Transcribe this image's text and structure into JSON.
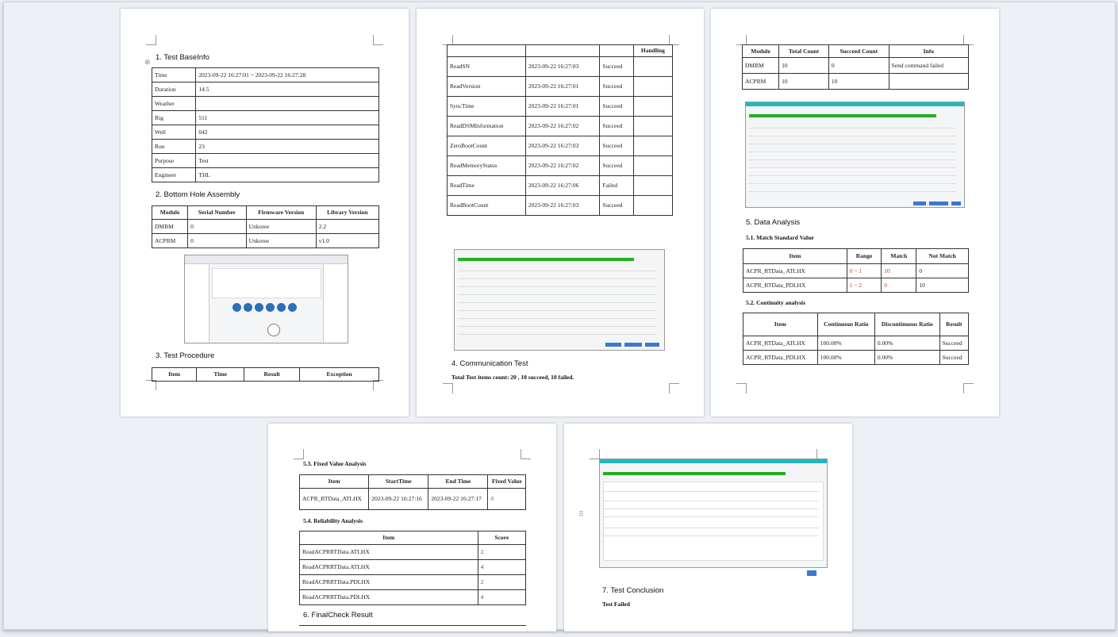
{
  "page1": {
    "h_base": "1. Test BaseInfo",
    "base": [
      {
        "k": "Time",
        "v": "2023-09-22 16:27:01 ~ 2023-09-22 16:27:28"
      },
      {
        "k": "Duration",
        "v": "14.5"
      },
      {
        "k": "Weather",
        "v": ""
      },
      {
        "k": "Rig",
        "v": "511"
      },
      {
        "k": "Well",
        "v": "042"
      },
      {
        "k": "Run",
        "v": "23"
      },
      {
        "k": "Purpose",
        "v": "Test"
      },
      {
        "k": "Engineer",
        "v": "THL"
      }
    ],
    "h_bha": "2. Bottom Hole Assembly",
    "bha_head": [
      "Module",
      "Serial Number",
      "Firmware Version",
      "Library Version"
    ],
    "bha_rows": [
      [
        "DMBM",
        "0",
        "Unkonw",
        "2.2"
      ],
      [
        "ACPRM",
        "0",
        "Unkonw",
        "v1.0"
      ]
    ],
    "h_proc": "3. Test Procedure",
    "proc_head": [
      "Item",
      "Time",
      "Result",
      "Exception"
    ]
  },
  "page2": {
    "head": [
      "",
      "",
      "",
      "Handling"
    ],
    "rows": [
      [
        "ReadSN",
        "2023-09-22 16:27:03",
        "Succeed",
        ""
      ],
      [
        "ReadVersion",
        "2023-09-22 16:27:01",
        "Succeed",
        ""
      ],
      [
        "SyncTime",
        "2023-09-22 16:27:01",
        "Succeed",
        ""
      ],
      [
        "ReadDSMInformation",
        "2023-09-22 16:27:02",
        "Succeed",
        ""
      ],
      [
        "ZeroBootCount",
        "2023-09-22 16:27:03",
        "Succeed",
        ""
      ],
      [
        "ReadMemoryStatus",
        "2023-09-22 16:27:02",
        "Succeed",
        ""
      ],
      [
        "ReadTime",
        "2023-09-22 16:27:06",
        "Failed",
        ""
      ],
      [
        "ReadBootCount",
        "2023-09-22 16:27:03",
        "Succeed",
        ""
      ]
    ],
    "h_comm": "4. Communication Test",
    "comm_summary": "Total Test items count: 20 , 10 succeed, 10 failed."
  },
  "page3": {
    "mod_head": [
      "Module",
      "Total Count",
      "Succeed Count",
      "Info"
    ],
    "mod_rows": [
      [
        "DMBM",
        "10",
        "0",
        "Send command failed"
      ],
      [
        "ACPRM",
        "10",
        "10",
        ""
      ]
    ],
    "h_data": "5. Data Analysis",
    "h_match": "5.1. Match Standard Value",
    "match_head": [
      "Item",
      "Range",
      "Match",
      "Not Match"
    ],
    "match_rows": [
      [
        "ACPR_RTData_ATLHX",
        "0 ~ 1",
        "10",
        "0"
      ],
      [
        "ACPR_RTData_PDLHX",
        "1 ~ 2",
        "0",
        "10"
      ]
    ],
    "h_cont": "5.2. Continuity analysis",
    "cont_head": [
      "Item",
      "Continuous Ratio",
      "Discontinuous Ratio",
      "Result"
    ],
    "cont_rows": [
      [
        "ACPR_RTData_ATLHX",
        "100.00%",
        "0.00%",
        "Succeed"
      ],
      [
        "ACPR_RTData_PDLHX",
        "100.00%",
        "0.00%",
        "Succeed"
      ]
    ]
  },
  "page4": {
    "h_fixed": "5.3. Fixed Value Analysis",
    "fixed_head": [
      "Item",
      "StartTime",
      "End Time",
      "Fixed Value"
    ],
    "fixed_rows": [
      [
        "ACPR_RTData_ATLHX",
        "2023-09-22 16:27:16",
        "2023-09-22 16:27:17",
        "0"
      ]
    ],
    "h_rel": "5.4. Reliability Analysis",
    "rel_head": [
      "Item",
      "Score"
    ],
    "rel_rows": [
      [
        "ReadACPRRTData.ATLHX",
        "2"
      ],
      [
        "ReadACPRRTData.ATLHX",
        "4"
      ],
      [
        "ReadACPRRTData.PDLHX",
        "2"
      ],
      [
        "ReadACPRRTData.PDLHX",
        "4"
      ]
    ],
    "h_final": "6. FinalCheck Result"
  },
  "page5": {
    "h_concl": "7. Test Conclusion",
    "conclusion": "Test Failed"
  },
  "colors": {
    "teal": "#20b8c0",
    "progress": "#20b020",
    "button": "#3a78d0",
    "red": "#c0392b"
  }
}
